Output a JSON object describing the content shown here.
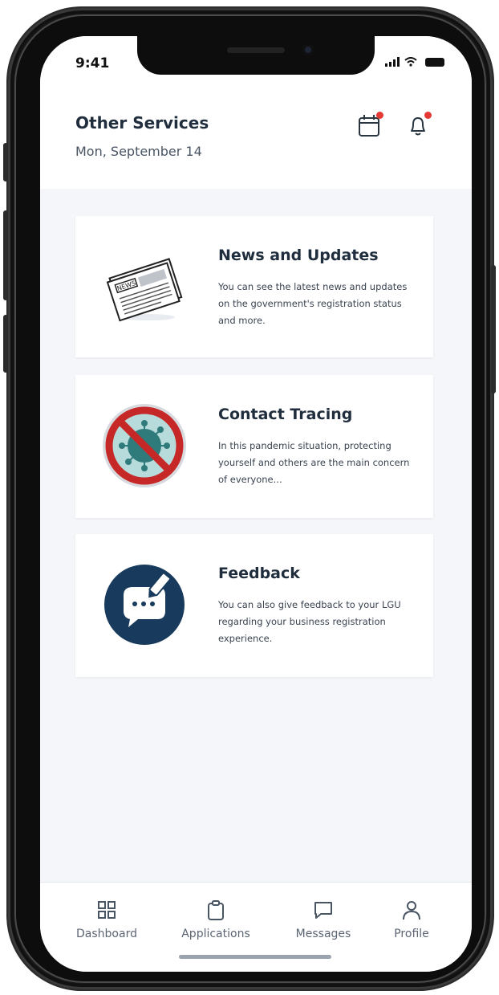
{
  "status_bar": {
    "time": "9:41"
  },
  "header": {
    "title": "Other Services",
    "date": "Mon, September 14",
    "calendar_icon": "calendar-icon",
    "bell_icon": "bell-icon",
    "badge_color": "#e53935"
  },
  "cards": [
    {
      "title": "News and Updates",
      "description": "You can see the latest news and updates on the government's registration status and more.",
      "illustration": "newspaper-icon",
      "illustration_text": "NEWS"
    },
    {
      "title": "Contact Tracing",
      "description": "In this pandemic situation, protecting yourself and others are the main concern of everyone...",
      "illustration": "no-virus-icon"
    },
    {
      "title": "Feedback",
      "description": "You can also give feedback to your LGU regarding your business registration experience.",
      "illustration": "feedback-chat-icon"
    }
  ],
  "bottom_nav": [
    {
      "label": "Dashboard",
      "icon": "grid-icon"
    },
    {
      "label": "Applications",
      "icon": "clipboard-icon"
    },
    {
      "label": "Messages",
      "icon": "chat-icon"
    },
    {
      "label": "Profile",
      "icon": "user-icon"
    }
  ],
  "colors": {
    "primary_dark": "#1f2d3d",
    "feedback_circle": "#183a5c",
    "badge": "#e53935",
    "screen_bg": "#f4f6f9"
  }
}
